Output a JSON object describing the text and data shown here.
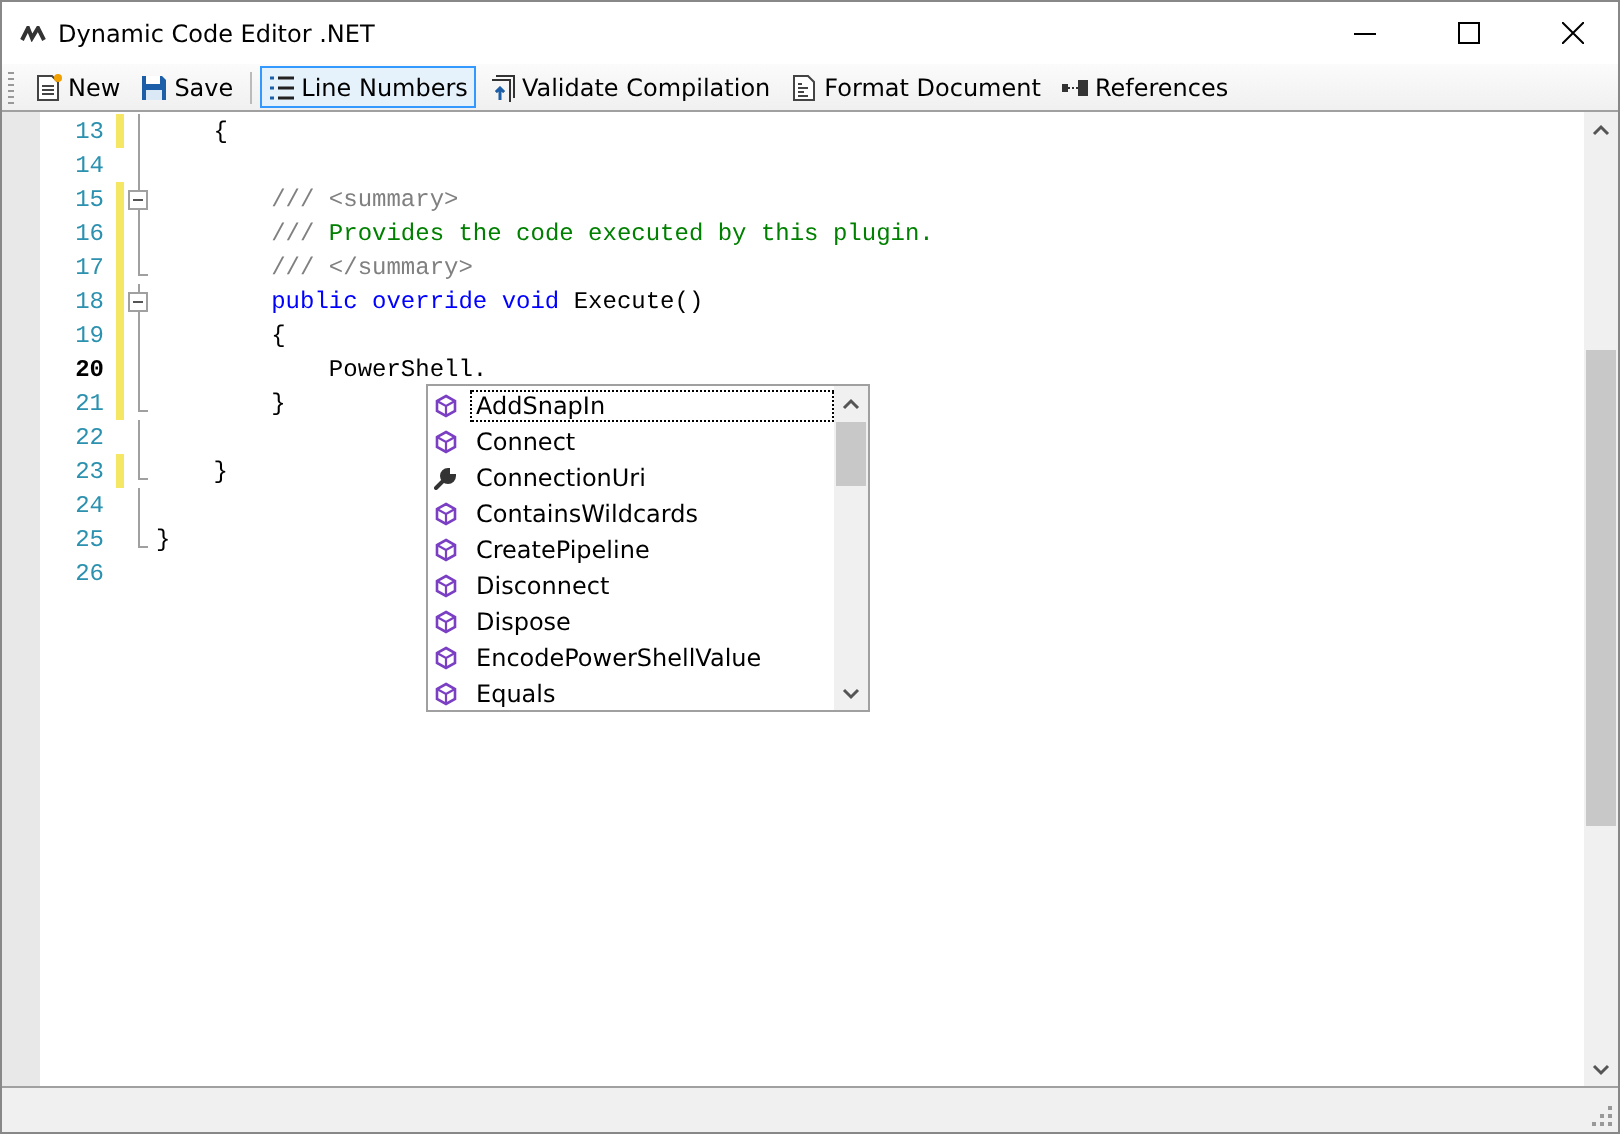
{
  "window": {
    "title": "Dynamic Code Editor .NET"
  },
  "toolbar": [
    {
      "kind": "new",
      "label": "New",
      "checked": false
    },
    {
      "kind": "save",
      "label": "Save",
      "checked": false
    },
    {
      "kind": "separator"
    },
    {
      "kind": "linenumbers",
      "label": "Line Numbers",
      "checked": true
    },
    {
      "kind": "validate",
      "label": "Validate Compilation",
      "checked": false
    },
    {
      "kind": "format",
      "label": "Format Document",
      "checked": false
    },
    {
      "kind": "references",
      "label": "References",
      "checked": false
    }
  ],
  "editor": {
    "lines": [
      {
        "number": "13",
        "changed": true,
        "current": false,
        "kind": "body",
        "tokens": [
          {
            "kind": "plain",
            "text": "    {"
          }
        ]
      },
      {
        "number": "14",
        "changed": false,
        "current": false,
        "kind": "body"
      },
      {
        "number": "15",
        "changed": true,
        "current": false,
        "kind": "start",
        "tokens": [
          {
            "kind": "doc",
            "text": "        /// <summary>"
          }
        ]
      },
      {
        "number": "16",
        "changed": true,
        "current": false,
        "kind": "body",
        "tokens": [
          {
            "kind": "doc",
            "text": "        /// "
          },
          {
            "kind": "comment",
            "text": "Provides the code executed by this plugin."
          }
        ]
      },
      {
        "number": "17",
        "changed": true,
        "current": false,
        "kind": "end",
        "tokens": [
          {
            "kind": "doc",
            "text": "        /// </summary>"
          }
        ]
      },
      {
        "number": "18",
        "changed": true,
        "current": false,
        "kind": "start",
        "tokens": [
          {
            "kind": "keyword",
            "text": "        public override void"
          },
          {
            "kind": "plain",
            "text": " Execute()"
          }
        ]
      },
      {
        "number": "19",
        "changed": true,
        "current": false,
        "kind": "body",
        "tokens": [
          {
            "kind": "plain",
            "text": "        {"
          }
        ]
      },
      {
        "number": "20",
        "changed": true,
        "current": true,
        "kind": "body",
        "tokens": [
          {
            "kind": "plain",
            "text": "            PowerShell."
          }
        ]
      },
      {
        "number": "21",
        "changed": true,
        "current": false,
        "kind": "end",
        "tokens": [
          {
            "kind": "plain",
            "text": "        }"
          }
        ]
      },
      {
        "number": "22",
        "changed": false,
        "current": false,
        "kind": "body"
      },
      {
        "number": "23",
        "changed": true,
        "current": false,
        "kind": "end",
        "tokens": [
          {
            "kind": "plain",
            "text": "    }"
          }
        ]
      },
      {
        "number": "24",
        "changed": false,
        "current": false,
        "kind": "body"
      },
      {
        "number": "25",
        "changed": false,
        "current": false,
        "kind": "end",
        "tokens": [
          {
            "kind": "plain",
            "text": "}"
          }
        ]
      },
      {
        "number": "26",
        "changed": false,
        "current": false,
        "kind": "plain"
      }
    ]
  },
  "completion": {
    "items": [
      {
        "kind": "method",
        "label": "AddSnapIn",
        "selected": true
      },
      {
        "kind": "method",
        "label": "Connect",
        "selected": false
      },
      {
        "kind": "property",
        "label": "ConnectionUri",
        "selected": false
      },
      {
        "kind": "method",
        "label": "ContainsWildcards",
        "selected": false
      },
      {
        "kind": "method",
        "label": "CreatePipeline",
        "selected": false
      },
      {
        "kind": "method",
        "label": "Disconnect",
        "selected": false
      },
      {
        "kind": "method",
        "label": "Dispose",
        "selected": false
      },
      {
        "kind": "method",
        "label": "EncodePowerShellValue",
        "selected": false
      },
      {
        "kind": "method",
        "label": "Equals",
        "selected": false
      }
    ]
  }
}
